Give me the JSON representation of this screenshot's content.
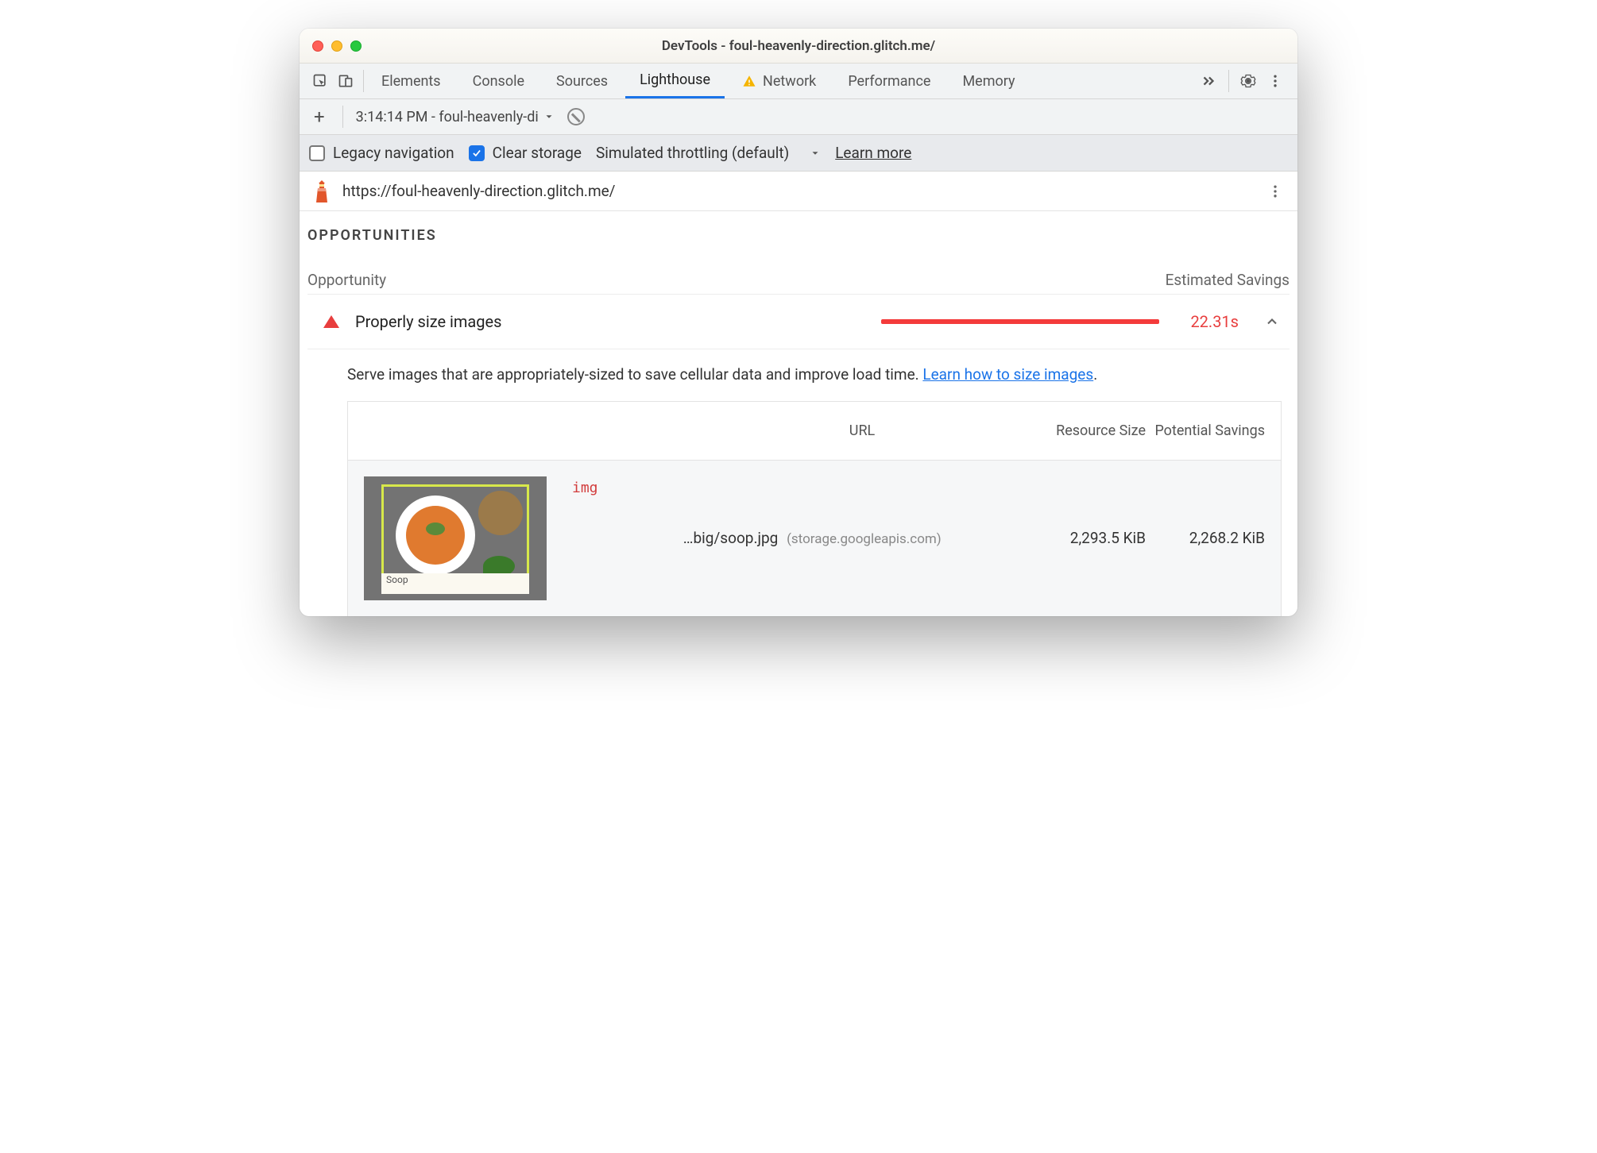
{
  "window": {
    "title": "DevTools - foul-heavenly-direction.glitch.me/"
  },
  "tabs": {
    "elements": "Elements",
    "console": "Console",
    "sources": "Sources",
    "lighthouse": "Lighthouse",
    "network": "Network",
    "performance": "Performance",
    "memory": "Memory"
  },
  "subbar": {
    "run_label": "3:14:14 PM - foul-heavenly-di"
  },
  "options": {
    "legacy_nav": "Legacy navigation",
    "clear_storage": "Clear storage",
    "throttling": "Simulated throttling (default)",
    "learn_more": "Learn more"
  },
  "report": {
    "url": "https://foul-heavenly-direction.glitch.me/",
    "section_title": "OPPORTUNITIES",
    "opportunity_col": "Opportunity",
    "savings_col": "Estimated Savings",
    "audit": {
      "title": "Properly size images",
      "savings": "22.31s",
      "description": "Serve images that are appropriately-sized to save cellular data and improve load time. ",
      "learn_link": "Learn how to size images"
    },
    "table": {
      "headers": {
        "url": "URL",
        "size": "Resource Size",
        "potential": "Potential Savings"
      },
      "row": {
        "tag": "img",
        "thumb_caption": "Soop",
        "path": "…big/soop.jpg",
        "host": "(storage.googleapis.com)",
        "size": "2,293.5 KiB",
        "potential": "2,268.2 KiB"
      }
    }
  }
}
